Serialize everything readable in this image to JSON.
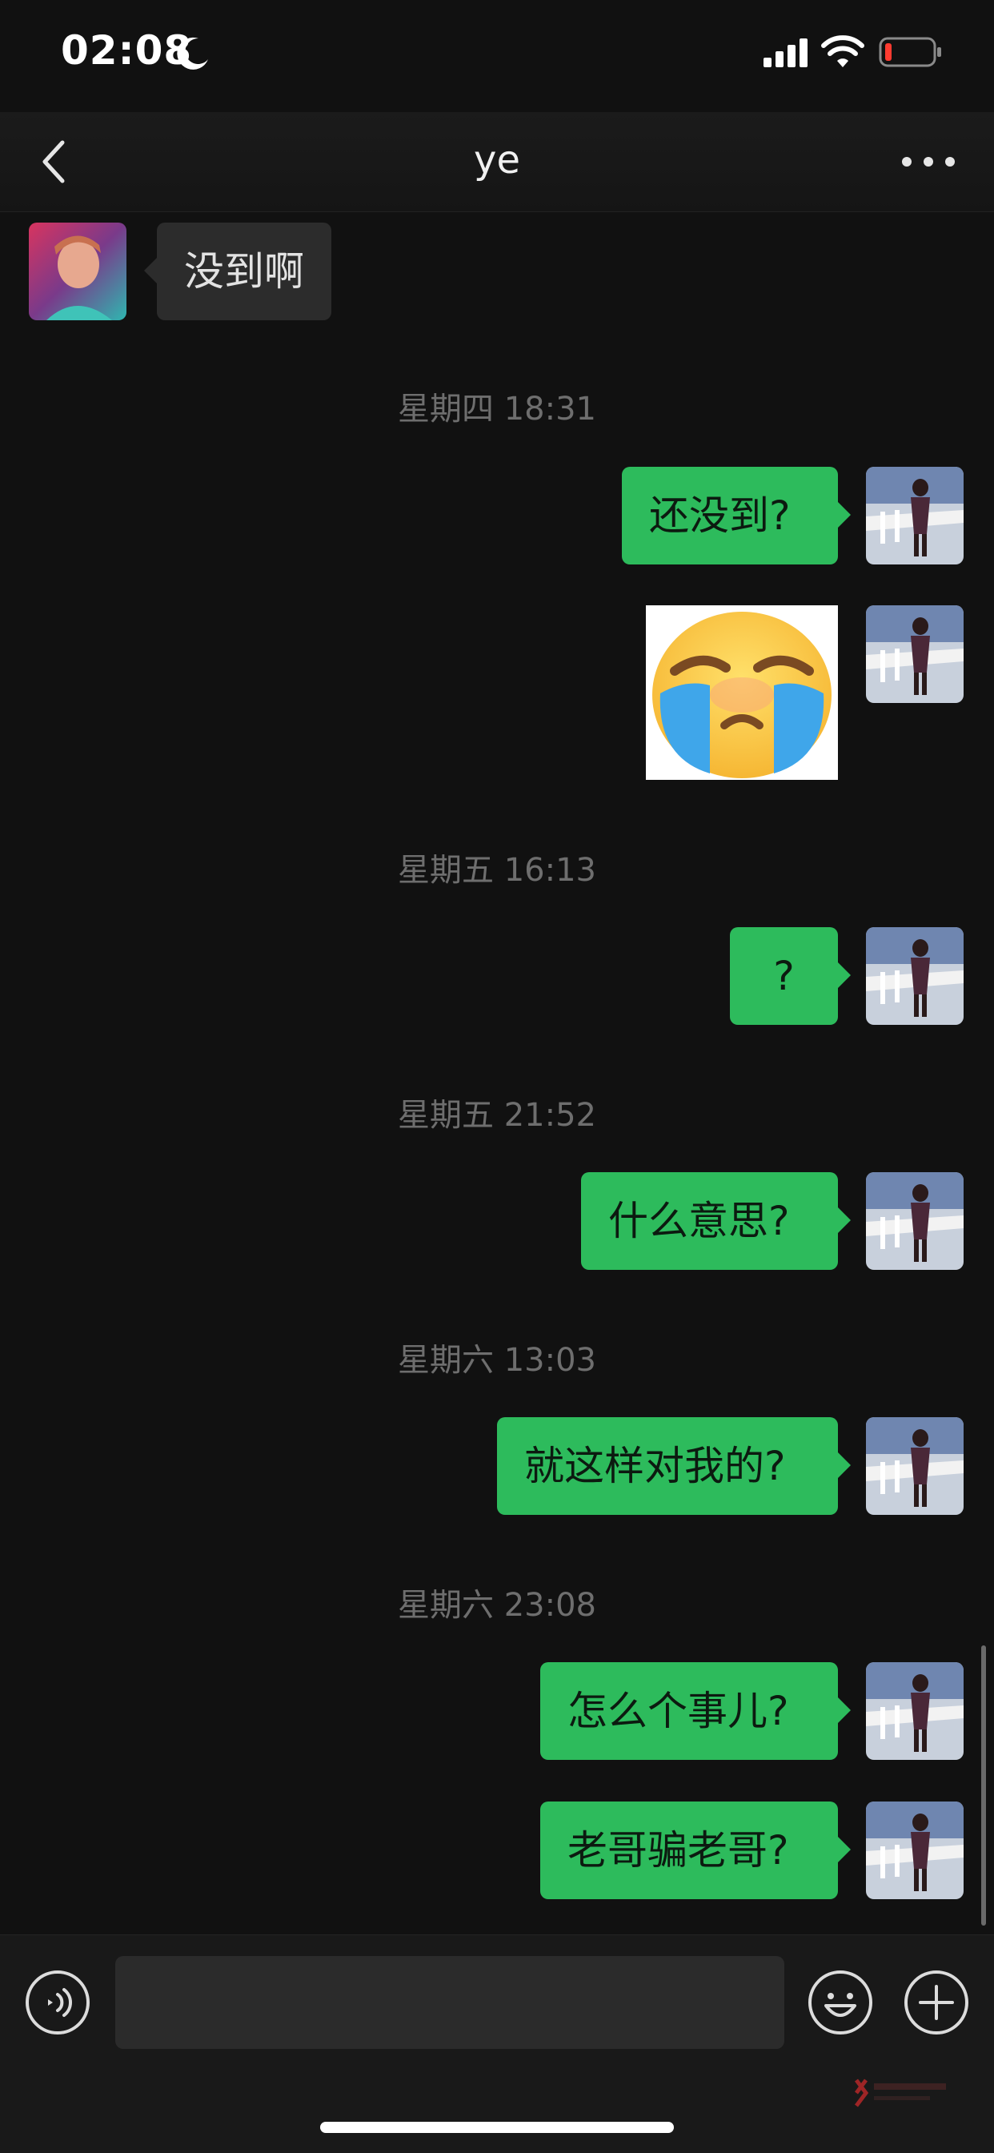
{
  "status_bar": {
    "time": "02:08"
  },
  "nav": {
    "title": "ye"
  },
  "messages": [
    {
      "type": "text",
      "direction": "incoming",
      "text": "没到啊"
    },
    {
      "type": "timestamp",
      "text": "星期四 18:31"
    },
    {
      "type": "text",
      "direction": "outgoing",
      "text": "还没到?"
    },
    {
      "type": "sticker",
      "direction": "outgoing",
      "icon": "crying-face-sticker"
    },
    {
      "type": "timestamp",
      "text": "星期五 16:13"
    },
    {
      "type": "text",
      "direction": "outgoing",
      "text": "?"
    },
    {
      "type": "timestamp",
      "text": "星期五 21:52"
    },
    {
      "type": "text",
      "direction": "outgoing",
      "text": "什么意思?"
    },
    {
      "type": "timestamp",
      "text": "星期六 13:03"
    },
    {
      "type": "text",
      "direction": "outgoing",
      "text": "就这样对我的?"
    },
    {
      "type": "timestamp",
      "text": "星期六 23:08"
    },
    {
      "type": "text",
      "direction": "outgoing",
      "text": "怎么个事儿?"
    },
    {
      "type": "text",
      "direction": "outgoing",
      "text": "老哥骗老哥?"
    }
  ],
  "input_bar": {
    "message_value": "",
    "icons": [
      "voice-icon",
      "emoji-icon",
      "plus-icon"
    ]
  },
  "colors": {
    "background": "#111111",
    "outgoing_bubble": "#2dbb5c",
    "incoming_bubble": "#2c2c2c",
    "timestamp_text": "#6e6e6e"
  }
}
